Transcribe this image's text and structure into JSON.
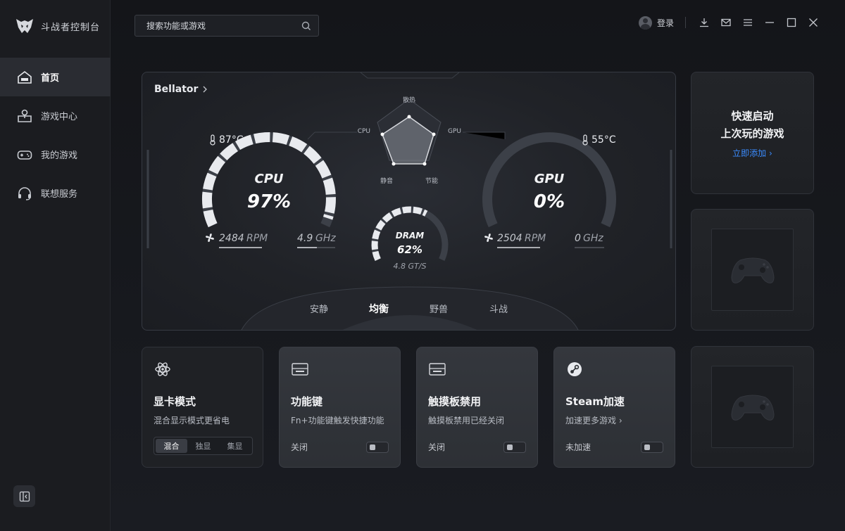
{
  "app": {
    "name": "斗战者控制台"
  },
  "sidebar": {
    "items": [
      {
        "label": "首页",
        "icon": "home-icon",
        "active": true
      },
      {
        "label": "游戏中心",
        "icon": "game-center-icon",
        "active": false
      },
      {
        "label": "我的游戏",
        "icon": "gamepad-icon",
        "active": false
      },
      {
        "label": "联想服务",
        "icon": "headset-icon",
        "active": false
      }
    ]
  },
  "search": {
    "placeholder": "搜索功能或游戏"
  },
  "topbar": {
    "login_label": "登录"
  },
  "device": {
    "name": "Bellator"
  },
  "radar": {
    "top": "散热",
    "left": "CPU",
    "right": "GPU",
    "bottom_left": "静音",
    "bottom_right": "节能"
  },
  "cpu": {
    "label": "CPU",
    "usage": "97%",
    "usage_value": 97,
    "temp": "87°C",
    "fan": "2484",
    "fan_unit": "RPM",
    "freq": "4.9",
    "freq_unit": "GHz"
  },
  "gpu": {
    "label": "GPU",
    "usage": "0%",
    "usage_value": 0,
    "temp": "55°C",
    "fan": "2504",
    "fan_unit": "RPM",
    "freq": "0",
    "freq_unit": "GHz"
  },
  "dram": {
    "label": "DRAM",
    "usage": "62%",
    "usage_value": 62,
    "speed": "4.8 GT/S"
  },
  "modes": {
    "items": [
      "安静",
      "均衡",
      "野兽",
      "斗战"
    ],
    "active": "均衡"
  },
  "quick_launch": {
    "line1": "快速启动",
    "line2": "上次玩的游戏",
    "link": "立即添加"
  },
  "cards": {
    "gpu_mode": {
      "title": "显卡模式",
      "subtitle": "混合显示模式更省电",
      "options": [
        "混合",
        "独显",
        "集显"
      ],
      "selected": "混合"
    },
    "fn_key": {
      "title": "功能键",
      "subtitle": "Fn+功能键触发快捷功能",
      "status": "关闭"
    },
    "touchpad": {
      "title": "触摸板禁用",
      "subtitle": "触摸板禁用已经关闭",
      "status": "关闭"
    },
    "steam": {
      "title": "Steam加速",
      "subtitle": "加速更多游戏",
      "status": "未加速"
    }
  },
  "colors": {
    "accent": "#3b8cff",
    "background": "#17191e",
    "panel": "#202227"
  }
}
